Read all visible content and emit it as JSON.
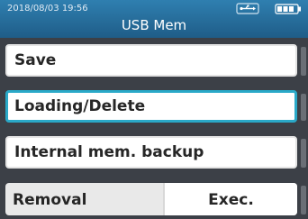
{
  "status_bar": {
    "datetime": "2018/08/03 19:56",
    "usb_icon": "usb-icon",
    "battery_icon": "battery-icon"
  },
  "header": {
    "title": "USB Mem"
  },
  "menu": {
    "items": [
      {
        "label": "Save",
        "selected": false
      },
      {
        "label": "Loading/Delete",
        "selected": true
      },
      {
        "label": "Internal mem. backup",
        "selected": false
      }
    ],
    "removal": {
      "label": "Removal",
      "button": "Exec."
    }
  },
  "colors": {
    "titlebar": "#1f5d88",
    "selection": "#2aa9c8",
    "background": "#3c4047"
  }
}
